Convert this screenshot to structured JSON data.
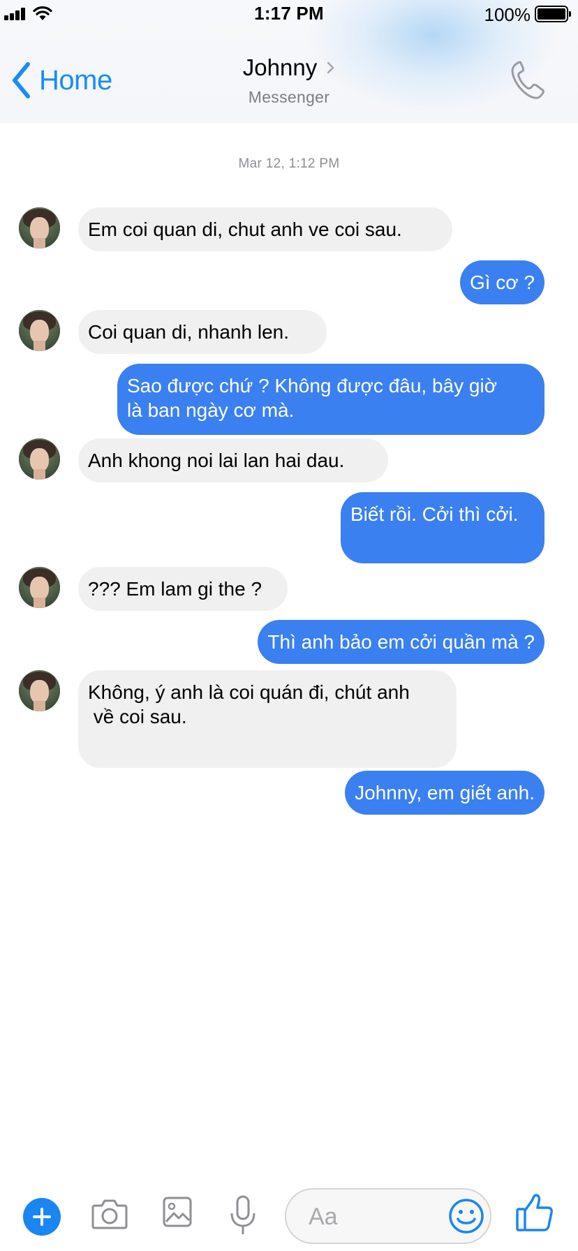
{
  "status_bar": {
    "time": "1:17 PM",
    "battery_percent": "100%",
    "battery_level": 1.0,
    "signal_bars": 4
  },
  "header": {
    "back_label": "Home",
    "contact_name": "Johnny",
    "subtitle": "Messenger",
    "icons": [
      "chevron-left-icon",
      "chevron-right-icon",
      "phone-icon"
    ]
  },
  "conversation": {
    "timestamp": "Mar 12, 1:12 PM",
    "messages": [
      {
        "sender": "contact",
        "text": "Em coi quan di, chut anh ve coi sau."
      },
      {
        "sender": "me",
        "text": "Gì cơ ?"
      },
      {
        "sender": "contact",
        "text": "Coi quan di, nhanh len."
      },
      {
        "sender": "me",
        "text": "Sao được chứ ? Không được đâu, bây giờ\nlà ban ngày cơ mà."
      },
      {
        "sender": "contact",
        "text": "Anh khong noi lai lan hai dau."
      },
      {
        "sender": "me",
        "text": "Biết rồi. Cởi thì cởi."
      },
      {
        "sender": "contact",
        "text": "??? Em lam gi the ?"
      },
      {
        "sender": "me",
        "text": "Thì anh bảo em cởi quần mà ?"
      },
      {
        "sender": "contact",
        "text": "Không, ý anh là coi quán đi, chút anh\n về coi sau."
      },
      {
        "sender": "me",
        "text": "Johnny, em giết anh."
      }
    ]
  },
  "composer": {
    "placeholder": "Aa",
    "accent_color": "#1a86f1",
    "tools": [
      "plus-icon",
      "camera-icon",
      "image-icon",
      "microphone-icon",
      "emoji-icon",
      "thumbs-up-icon"
    ]
  },
  "colors": {
    "outgoing_bubble": "#3a80f0",
    "incoming_bubble": "#f0f0f0",
    "link_blue": "#1a8cf4"
  }
}
